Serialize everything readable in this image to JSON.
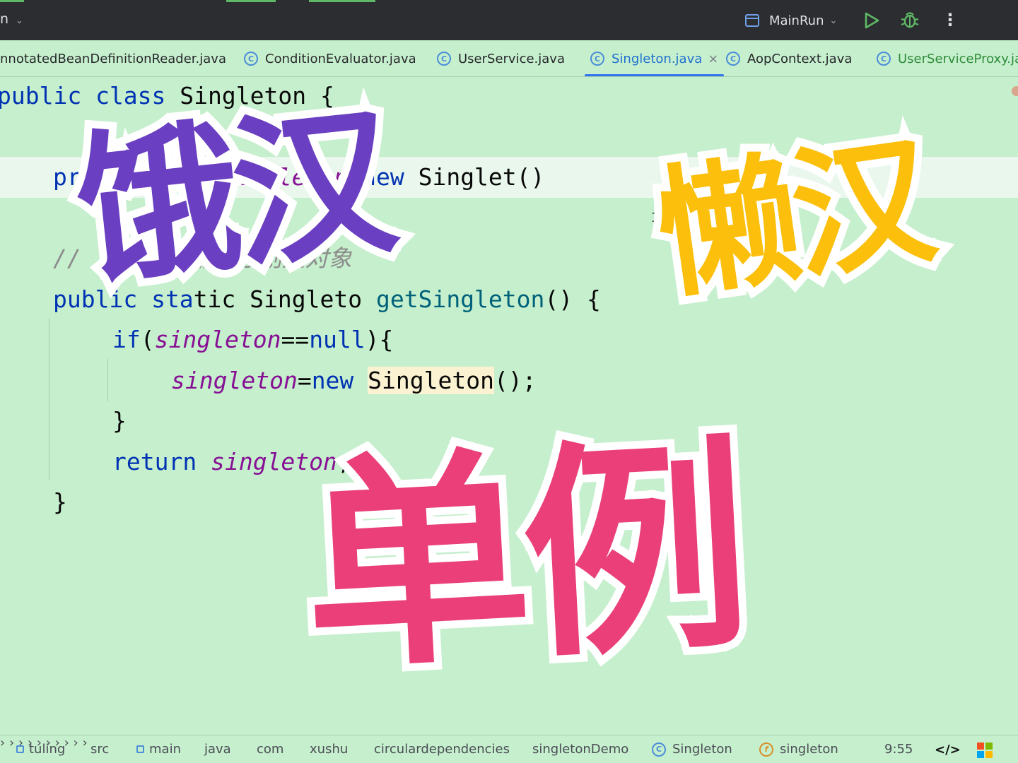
{
  "toolbar": {
    "menu_fragment": "n",
    "run_config": "MainRun",
    "icons": [
      "chevron-down-icon",
      "run-config-icon",
      "run-icon",
      "debug-icon",
      "more-vertical-icon"
    ]
  },
  "tabs": [
    {
      "label": "nnotatedBeanDefinitionReader.java",
      "icon": ""
    },
    {
      "label": "ConditionEvaluator.java",
      "icon": "class-icon"
    },
    {
      "label": "UserService.java",
      "icon": "class-icon"
    },
    {
      "label": "Singleton.java",
      "icon": "class-icon",
      "active": true,
      "close": "×"
    },
    {
      "label": "AopContext.java",
      "icon": "class-icon"
    },
    {
      "label": "UserServiceProxy.ja",
      "icon": "class-icon"
    }
  ],
  "code": {
    "l1": {
      "kw": "public class ",
      "name": "Singleton {"
    },
    "l2": {
      "kw": "pri",
      "t1": "",
      "hidden": "ingleton ",
      "fld": "singleton",
      "op": "=",
      "kw2": "new",
      "t2": " Singlet",
      "t3": "()"
    },
    "l3": {
      "comment": "// 第一次使用时才创建对象"
    },
    "l4": {
      "kw": "public sta",
      "t1": "tic Singleto",
      "kw2": "",
      "fn": "getSingleton",
      "rest": "() {"
    },
    "l5": {
      "kw": "if",
      "p1": "(",
      "fld": "singleton",
      "op": "==",
      "kw2": "null",
      "rest": "){"
    },
    "l6": {
      "fld": "singleton",
      "op": "=",
      "kw": "new",
      "sp": " ",
      "usage": "Singleton",
      "rest": "();"
    },
    "l7": {
      "text": "}"
    },
    "l8": {
      "kw": "return",
      "sp": " ",
      "fld": "singleton",
      "rest": ";"
    },
    "l9": {
      "text": "}"
    }
  },
  "overlay": {
    "ehan": "饿汉",
    "lanhan": "懒汉",
    "danli": "单例",
    "colors": {
      "ehan": "#6a3fc1",
      "lanhan": "#fbbf0c",
      "danli": "#ea3f79"
    }
  },
  "statusbar": {
    "breadcrumbs": [
      "tuling",
      "src",
      "main",
      "java",
      "com",
      "xushu",
      "circulardependencies",
      "singletonDemo",
      "Singleton",
      "singleton"
    ],
    "time": "9:55",
    "icons": [
      "module-icon",
      "class-icon",
      "field-icon",
      "code-icon",
      "windows-icon"
    ]
  }
}
